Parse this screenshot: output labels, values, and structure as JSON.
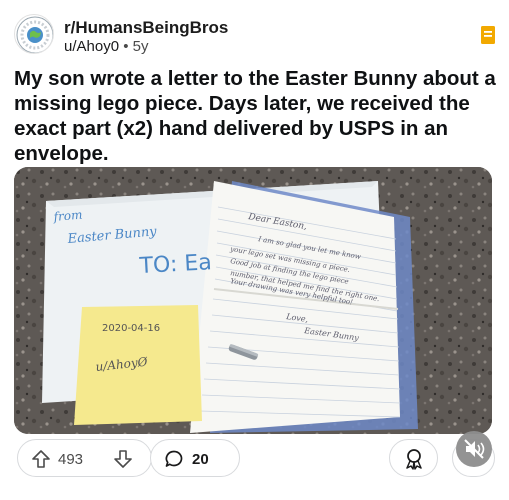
{
  "post": {
    "subreddit": "r/HumansBeingBros",
    "user": "u/Ahoy0",
    "separator": "•",
    "age": "5y",
    "title": "My son wrote a letter to the Easter Bunny about a missing lego piece. Days later, we received the exact part (x2) hand delivered by USPS in an envelope."
  },
  "image": {
    "envelope_from": "from",
    "envelope_sender": "Easter Bunny",
    "envelope_to": "TO: Ea",
    "note_date": "2020-04-16",
    "note_user": "u/AhoyØ",
    "letter_greeting": "Dear Easton,",
    "letter_line1": "I am so glad you let me know",
    "letter_line2": "your lego set was missing a piece.",
    "letter_line3": "Good job at finding the lego piece",
    "letter_line4": "number, that helped me find the right one.",
    "letter_line5": "Your drawing was very helpful too!",
    "letter_closing": "Love,",
    "letter_signature": "Easter Bunny"
  },
  "actions": {
    "votes": "493",
    "comments": "20"
  },
  "icons": {
    "subreddit_avatar": "subreddit-avatar-icon",
    "bookmark": "bookmark-icon",
    "upvote": "arrow-up-icon",
    "downvote": "arrow-down-icon",
    "comment": "speech-bubble-icon",
    "award": "award-icon",
    "mute": "mute-icon"
  },
  "colors": {
    "bookmark": "#f2a900",
    "note": "#f5e98e",
    "envelope": "#eef2f4",
    "counter": "#b8b8b8",
    "mute_badge": "#8e8e8e"
  }
}
